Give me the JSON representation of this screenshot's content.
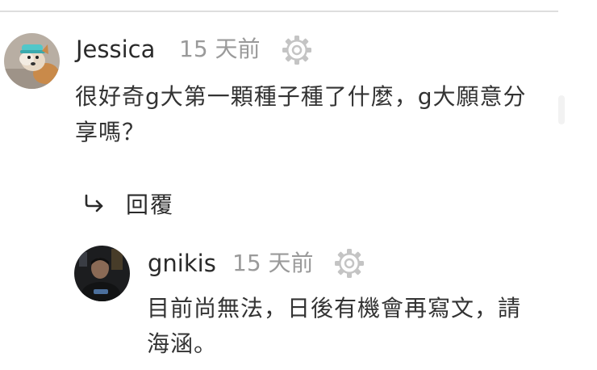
{
  "comments": [
    {
      "author": "Jessica",
      "time": "15 天前",
      "text_lines": [
        "很好奇g大第一顆種子種了什麼，g大願意分",
        "享嗎？"
      ],
      "avatar": "dog-avatar"
    }
  ],
  "reply_action": {
    "icon": "reply-arrow-icon",
    "label": "回覆"
  },
  "replies": [
    {
      "author": "gnikis",
      "time": "15 天前",
      "text_lines": [
        "目前尚無法，日後有機會再寫文，請",
        "海涵。"
      ],
      "avatar": "person-avatar"
    }
  ],
  "colors": {
    "author": "#2a2a2a",
    "time": "#9a9a9a",
    "text": "#333333",
    "gear": "#c4c4c4",
    "divider": "#dedede"
  }
}
